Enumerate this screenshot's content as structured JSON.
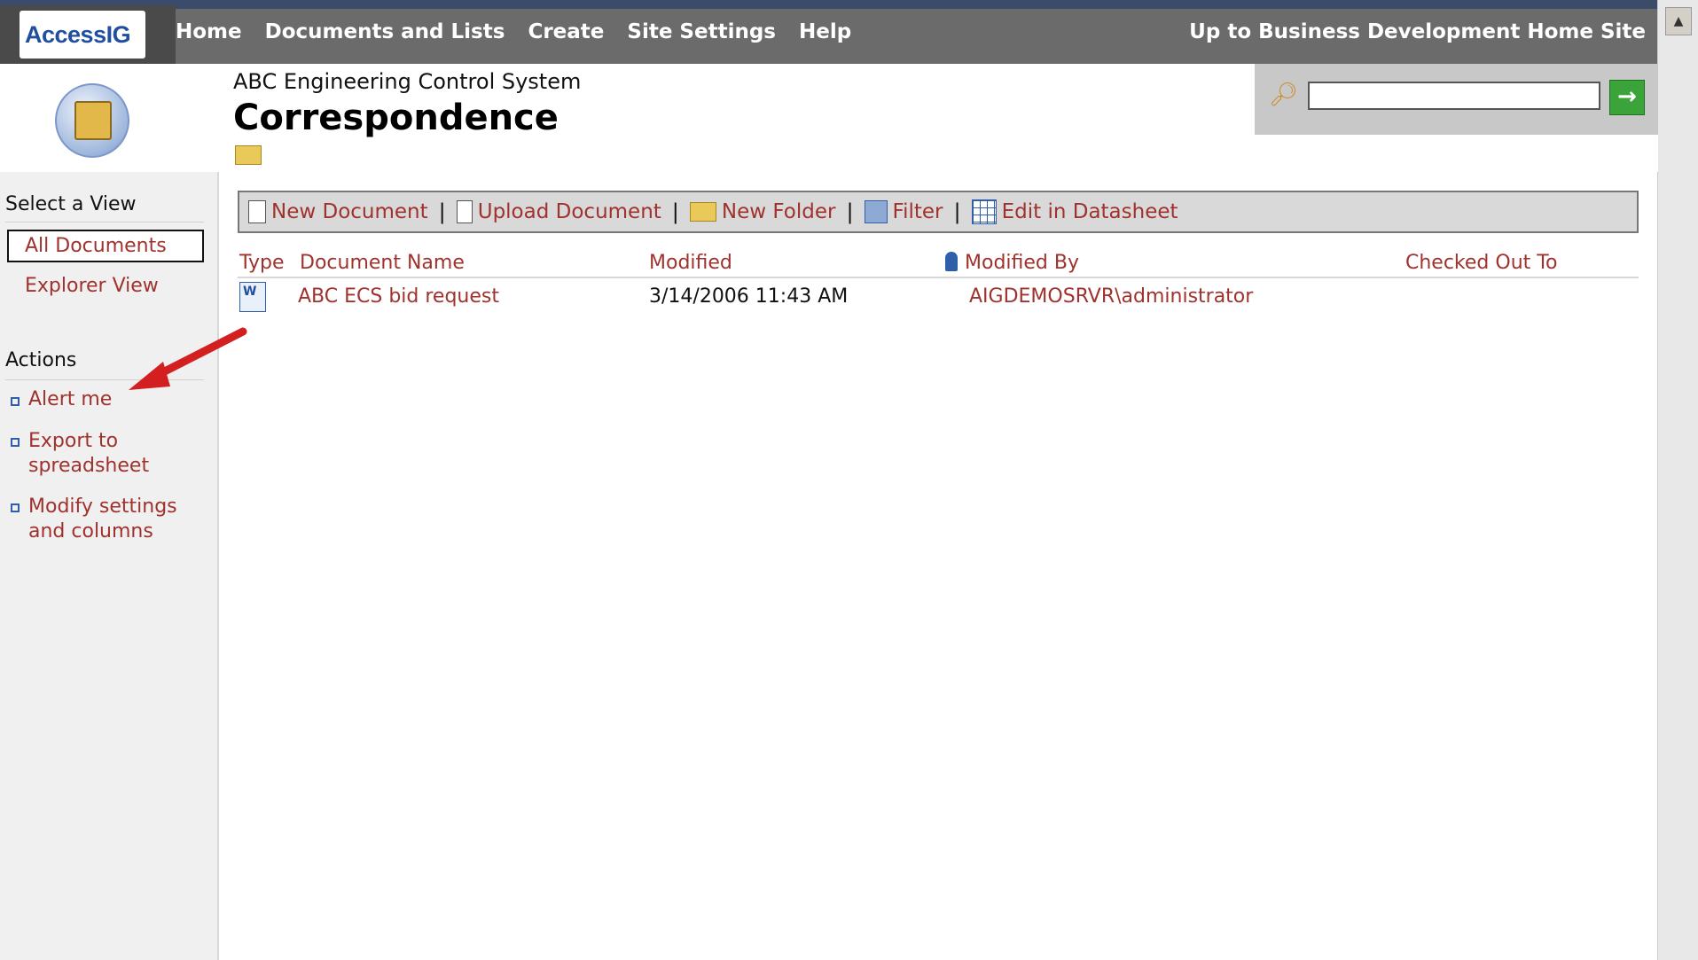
{
  "topbar": {
    "logo_text": "AccessIG",
    "nav": [
      "Home",
      "Documents and Lists",
      "Create",
      "Site Settings",
      "Help"
    ],
    "up_link": "Up to Business Development Home Site"
  },
  "header": {
    "site_name": "ABC Engineering Control System",
    "page_title": "Correspondence",
    "search_value": ""
  },
  "sidebar": {
    "view_heading": "Select a View",
    "views": [
      "All Documents",
      "Explorer View"
    ],
    "actions_heading": "Actions",
    "actions": [
      "Alert me",
      "Export to spreadsheet",
      "Modify settings and columns"
    ]
  },
  "toolbar": {
    "new_document": "New Document",
    "upload_document": "Upload Document",
    "new_folder": "New Folder",
    "filter": "Filter",
    "edit_datasheet": "Edit in Datasheet"
  },
  "list": {
    "columns": [
      "Type",
      "Document Name",
      "Modified",
      "Modified By",
      "Checked Out To"
    ],
    "rows": [
      {
        "type_icon": "word-doc-icon",
        "name": "ABC ECS bid request",
        "modified": "3/14/2006 11:43 AM",
        "modified_by": "AIGDEMOSRVR\\administrator",
        "checked_out_to": ""
      }
    ]
  },
  "colors": {
    "link": "#a0322e",
    "topbar": "#6b6b6b",
    "annotation_arrow": "#d31f1f"
  }
}
